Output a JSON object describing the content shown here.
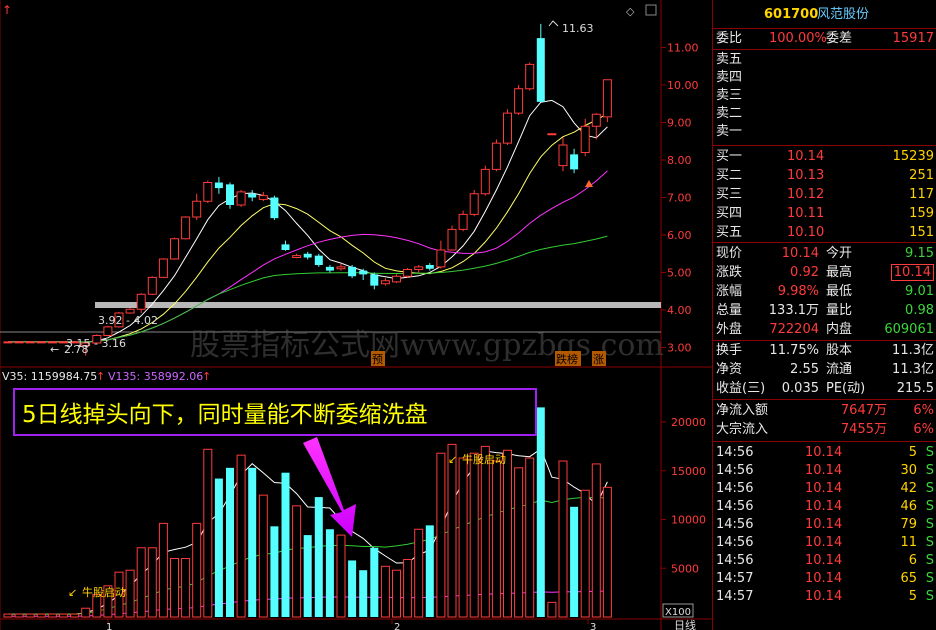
{
  "stock": {
    "code": "601700",
    "name": "风范股份"
  },
  "quote": {
    "weibi_label": "委比",
    "weibi": "100.00%",
    "weicha_label": "委差",
    "weicha": "15917",
    "sell": [
      {
        "label": "卖五",
        "price": "",
        "vol": ""
      },
      {
        "label": "卖四",
        "price": "",
        "vol": ""
      },
      {
        "label": "卖三",
        "price": "",
        "vol": ""
      },
      {
        "label": "卖二",
        "price": "",
        "vol": ""
      },
      {
        "label": "卖一",
        "price": "",
        "vol": ""
      }
    ],
    "buy": [
      {
        "label": "买一",
        "price": "10.14",
        "vol": "15239"
      },
      {
        "label": "买二",
        "price": "10.13",
        "vol": "251"
      },
      {
        "label": "买三",
        "price": "10.12",
        "vol": "117"
      },
      {
        "label": "买四",
        "price": "10.11",
        "vol": "159"
      },
      {
        "label": "买五",
        "price": "10.10",
        "vol": "151"
      }
    ],
    "stats": [
      {
        "l1": "现价",
        "v1": "10.14",
        "c1": "red",
        "l2": "今开",
        "v2": "9.15",
        "c2": "grn"
      },
      {
        "l1": "涨跌",
        "v1": "0.92",
        "c1": "red",
        "l2": "最高",
        "v2": "10.14",
        "c2": "red"
      },
      {
        "l1": "涨幅",
        "v1": "9.98%",
        "c1": "red",
        "l2": "最低",
        "v2": "9.01",
        "c2": "grn"
      },
      {
        "l1": "总量",
        "v1": "133.1万",
        "c1": "wht",
        "l2": "量比",
        "v2": "0.98",
        "c2": "grn"
      },
      {
        "l1": "外盘",
        "v1": "722204",
        "c1": "red",
        "l2": "内盘",
        "v2": "609061",
        "c2": "grn"
      }
    ],
    "fund": [
      {
        "l1": "换手",
        "v1": "11.75%",
        "l2": "股本",
        "v2": "11.3亿"
      },
      {
        "l1": "净资",
        "v1": "2.55",
        "l2": "流通",
        "v2": "11.3亿"
      },
      {
        "l1": "收益(三)",
        "v1": "0.035",
        "l2": "PE(动)",
        "v2": "215.5"
      }
    ],
    "flow": [
      {
        "label": "净流入额",
        "amount": "7647万",
        "pct": "6%"
      },
      {
        "label": "大宗流入",
        "amount": "7455万",
        "pct": "6%"
      }
    ],
    "ticks": [
      {
        "time": "14:56",
        "price": "10.14",
        "vol": "5",
        "side": "S"
      },
      {
        "time": "14:56",
        "price": "10.14",
        "vol": "30",
        "side": "S"
      },
      {
        "time": "14:56",
        "price": "10.14",
        "vol": "42",
        "side": "S"
      },
      {
        "time": "14:56",
        "price": "10.14",
        "vol": "46",
        "side": "S"
      },
      {
        "time": "14:56",
        "price": "10.14",
        "vol": "79",
        "side": "S"
      },
      {
        "time": "14:56",
        "price": "10.14",
        "vol": "11",
        "side": "S"
      },
      {
        "time": "14:56",
        "price": "10.14",
        "vol": "6",
        "side": "S"
      },
      {
        "time": "14:57",
        "price": "10.14",
        "vol": "65",
        "side": "S"
      },
      {
        "time": "14:57",
        "price": "10.14",
        "vol": "5",
        "side": "S"
      }
    ]
  },
  "chart_texts": {
    "high_label": "11.63",
    "low_label": "2.78",
    "range1": "3.92 - 4.02",
    "range2": "3.15 - 3.16",
    "watermark": "股票指标公式网www.gpzbgs.com",
    "tag_yu": "预",
    "tag_die": "跌榜",
    "tag_zhang": "涨",
    "vol_header_1": "V35: 1159984.75",
    "vol_header_2": "V135: 358992.06",
    "annotation": "5日线掉头向下，同时量能不断委缩洗盘",
    "bull_start_1": "牛股启动",
    "bull_start_2": "牛股启动",
    "x100": "X100",
    "day_line": "日线",
    "x_ticks": [
      "1",
      "2",
      "3"
    ]
  },
  "chart_data": {
    "type": "candlestick",
    "price_axis": {
      "ticks": [
        3.0,
        4.0,
        5.0,
        6.0,
        7.0,
        8.0,
        9.0,
        10.0,
        11.0
      ],
      "range": [
        2.8,
        12.0
      ]
    },
    "volume_axis": {
      "ticks": [
        5000,
        10000,
        15000,
        20000
      ],
      "range": [
        0,
        24000
      ]
    },
    "candles": [
      {
        "o": 3.15,
        "c": 3.15,
        "h": 3.16,
        "l": 3.14,
        "v": 300
      },
      {
        "o": 3.15,
        "c": 3.15,
        "h": 3.16,
        "l": 3.14,
        "v": 300
      },
      {
        "o": 3.15,
        "c": 3.15,
        "h": 3.16,
        "l": 3.14,
        "v": 300
      },
      {
        "o": 3.15,
        "c": 3.15,
        "h": 3.16,
        "l": 3.14,
        "v": 300
      },
      {
        "o": 3.15,
        "c": 3.15,
        "h": 3.16,
        "l": 3.14,
        "v": 300
      },
      {
        "o": 3.15,
        "c": 3.15,
        "h": 3.16,
        "l": 3.14,
        "v": 300
      },
      {
        "o": 3.15,
        "c": 3.15,
        "h": 3.16,
        "l": 3.14,
        "v": 300
      },
      {
        "o": 3.05,
        "c": 3.12,
        "h": 3.16,
        "l": 2.78,
        "v": 900
      },
      {
        "o": 3.12,
        "c": 3.32,
        "h": 3.35,
        "l": 3.1,
        "v": 2300
      },
      {
        "o": 3.32,
        "c": 3.55,
        "h": 3.58,
        "l": 3.3,
        "v": 3200
      },
      {
        "o": 3.55,
        "c": 3.92,
        "h": 3.95,
        "l": 3.53,
        "v": 4600
      },
      {
        "o": 3.92,
        "c": 4.02,
        "h": 4.05,
        "l": 3.9,
        "v": 4800
      },
      {
        "o": 4.02,
        "c": 4.42,
        "h": 4.45,
        "l": 3.92,
        "v": 7100
      },
      {
        "o": 4.42,
        "c": 4.87,
        "h": 4.9,
        "l": 4.4,
        "v": 7100
      },
      {
        "o": 4.87,
        "c": 5.36,
        "h": 5.38,
        "l": 4.85,
        "v": 9600
      },
      {
        "o": 5.36,
        "c": 5.9,
        "h": 5.93,
        "l": 5.34,
        "v": 6000
      },
      {
        "o": 5.9,
        "c": 6.48,
        "h": 6.5,
        "l": 5.88,
        "v": 6000
      },
      {
        "o": 6.48,
        "c": 6.9,
        "h": 7.1,
        "l": 6.4,
        "v": 9600
      },
      {
        "o": 6.9,
        "c": 7.4,
        "h": 7.45,
        "l": 6.85,
        "v": 17200
      },
      {
        "o": 7.4,
        "c": 7.25,
        "h": 7.55,
        "l": 7.1,
        "v": 14200
      },
      {
        "o": 7.35,
        "c": 6.8,
        "h": 7.4,
        "l": 6.7,
        "v": 15300
      },
      {
        "o": 6.8,
        "c": 7.15,
        "h": 7.2,
        "l": 6.75,
        "v": 16600
      },
      {
        "o": 7.1,
        "c": 7.0,
        "h": 7.2,
        "l": 6.9,
        "v": 15300
      },
      {
        "o": 6.95,
        "c": 7.05,
        "h": 7.15,
        "l": 6.9,
        "v": 12500
      },
      {
        "o": 7.0,
        "c": 6.45,
        "h": 7.05,
        "l": 6.4,
        "v": 9300
      },
      {
        "o": 5.75,
        "c": 5.6,
        "h": 5.85,
        "l": 5.58,
        "v": 14800
      },
      {
        "o": 5.4,
        "c": 5.45,
        "h": 5.5,
        "l": 5.38,
        "v": 11400
      },
      {
        "o": 5.5,
        "c": 5.4,
        "h": 5.55,
        "l": 5.35,
        "v": 8400
      },
      {
        "o": 5.45,
        "c": 5.2,
        "h": 5.5,
        "l": 5.15,
        "v": 12300
      },
      {
        "o": 5.15,
        "c": 5.05,
        "h": 5.2,
        "l": 5.0,
        "v": 9000
      },
      {
        "o": 5.1,
        "c": 5.15,
        "h": 5.25,
        "l": 5.05,
        "v": 8400
      },
      {
        "o": 5.15,
        "c": 4.9,
        "h": 5.2,
        "l": 4.85,
        "v": 5800
      },
      {
        "o": 5.05,
        "c": 4.95,
        "h": 5.1,
        "l": 4.8,
        "v": 4800
      },
      {
        "o": 4.95,
        "c": 4.65,
        "h": 5.0,
        "l": 4.55,
        "v": 7100
      },
      {
        "o": 4.7,
        "c": 4.78,
        "h": 4.85,
        "l": 4.65,
        "v": 5200
      },
      {
        "o": 4.75,
        "c": 4.9,
        "h": 4.95,
        "l": 4.72,
        "v": 4800
      },
      {
        "o": 4.9,
        "c": 5.08,
        "h": 5.12,
        "l": 4.85,
        "v": 5900
      },
      {
        "o": 5.08,
        "c": 5.15,
        "h": 5.2,
        "l": 5.0,
        "v": 9000
      },
      {
        "o": 5.2,
        "c": 5.1,
        "h": 5.25,
        "l": 5.05,
        "v": 9400
      },
      {
        "o": 5.15,
        "c": 5.6,
        "h": 5.85,
        "l": 5.1,
        "v": 16800
      },
      {
        "o": 5.6,
        "c": 6.15,
        "h": 6.25,
        "l": 5.58,
        "v": 17700
      },
      {
        "o": 6.15,
        "c": 6.55,
        "h": 6.65,
        "l": 6.1,
        "v": 16300
      },
      {
        "o": 6.55,
        "c": 7.1,
        "h": 7.2,
        "l": 6.5,
        "v": 16800
      },
      {
        "o": 7.1,
        "c": 7.75,
        "h": 7.85,
        "l": 7.05,
        "v": 17500
      },
      {
        "o": 7.75,
        "c": 8.45,
        "h": 8.55,
        "l": 7.7,
        "v": 16000
      },
      {
        "o": 8.45,
        "c": 9.25,
        "h": 9.35,
        "l": 8.4,
        "v": 17100
      },
      {
        "o": 9.25,
        "c": 9.9,
        "h": 10.0,
        "l": 9.2,
        "v": 15300
      },
      {
        "o": 9.9,
        "c": 10.55,
        "h": 10.6,
        "l": 9.85,
        "v": 16300
      },
      {
        "o": 11.25,
        "c": 9.55,
        "h": 11.63,
        "l": 9.55,
        "v": 21500
      },
      {
        "o": 8.7,
        "c": 8.7,
        "h": 8.72,
        "l": 8.68,
        "v": 1500
      },
      {
        "o": 7.85,
        "c": 8.4,
        "h": 8.6,
        "l": 7.7,
        "v": 16000
      },
      {
        "o": 8.15,
        "c": 7.75,
        "h": 8.3,
        "l": 7.65,
        "v": 11300
      },
      {
        "o": 8.2,
        "c": 8.9,
        "h": 9.1,
        "l": 8.1,
        "v": 13000
      },
      {
        "o": 8.9,
        "c": 9.22,
        "h": 9.25,
        "l": 8.55,
        "v": 15700
      },
      {
        "o": 9.15,
        "c": 10.14,
        "h": 10.14,
        "l": 9.01,
        "v": 13300
      }
    ]
  }
}
